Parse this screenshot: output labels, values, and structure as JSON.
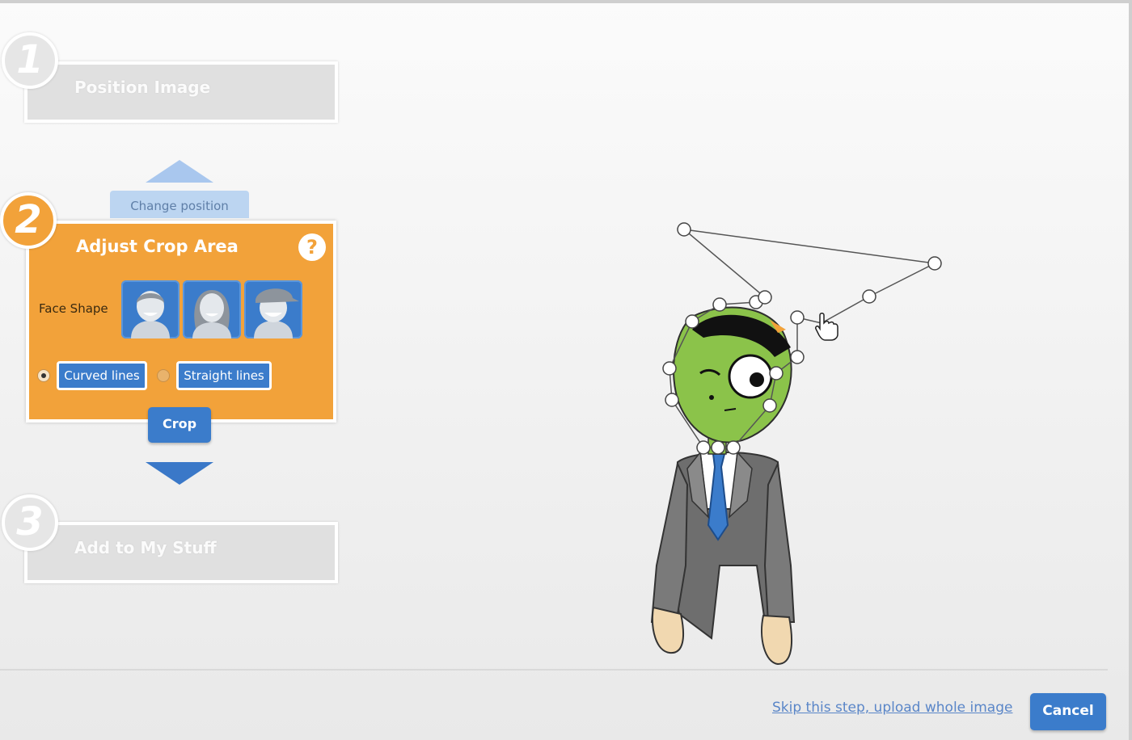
{
  "steps": [
    {
      "number": "1",
      "title": "Position Image"
    },
    {
      "number": "2",
      "title": "Adjust Crop Area"
    },
    {
      "number": "3",
      "title": "Add to My Stuff"
    }
  ],
  "change_position_label": "Change position",
  "help_label": "?",
  "face_shape": {
    "label": "Face Shape",
    "options": [
      "face-shape-short-hair-icon",
      "face-shape-long-hair-icon",
      "face-shape-cap-icon"
    ]
  },
  "line_options": {
    "curved_label": "Curved lines",
    "straight_label": "Straight lines",
    "selected": "Curved lines"
  },
  "crop_label": "Crop",
  "skip_link_label": "Skip this step, upload whole image",
  "cancel_label": "Cancel",
  "colors": {
    "active_step": "#f2a23a",
    "button_blue": "#3b7ccb",
    "inactive_step": "#e0e0e0"
  }
}
